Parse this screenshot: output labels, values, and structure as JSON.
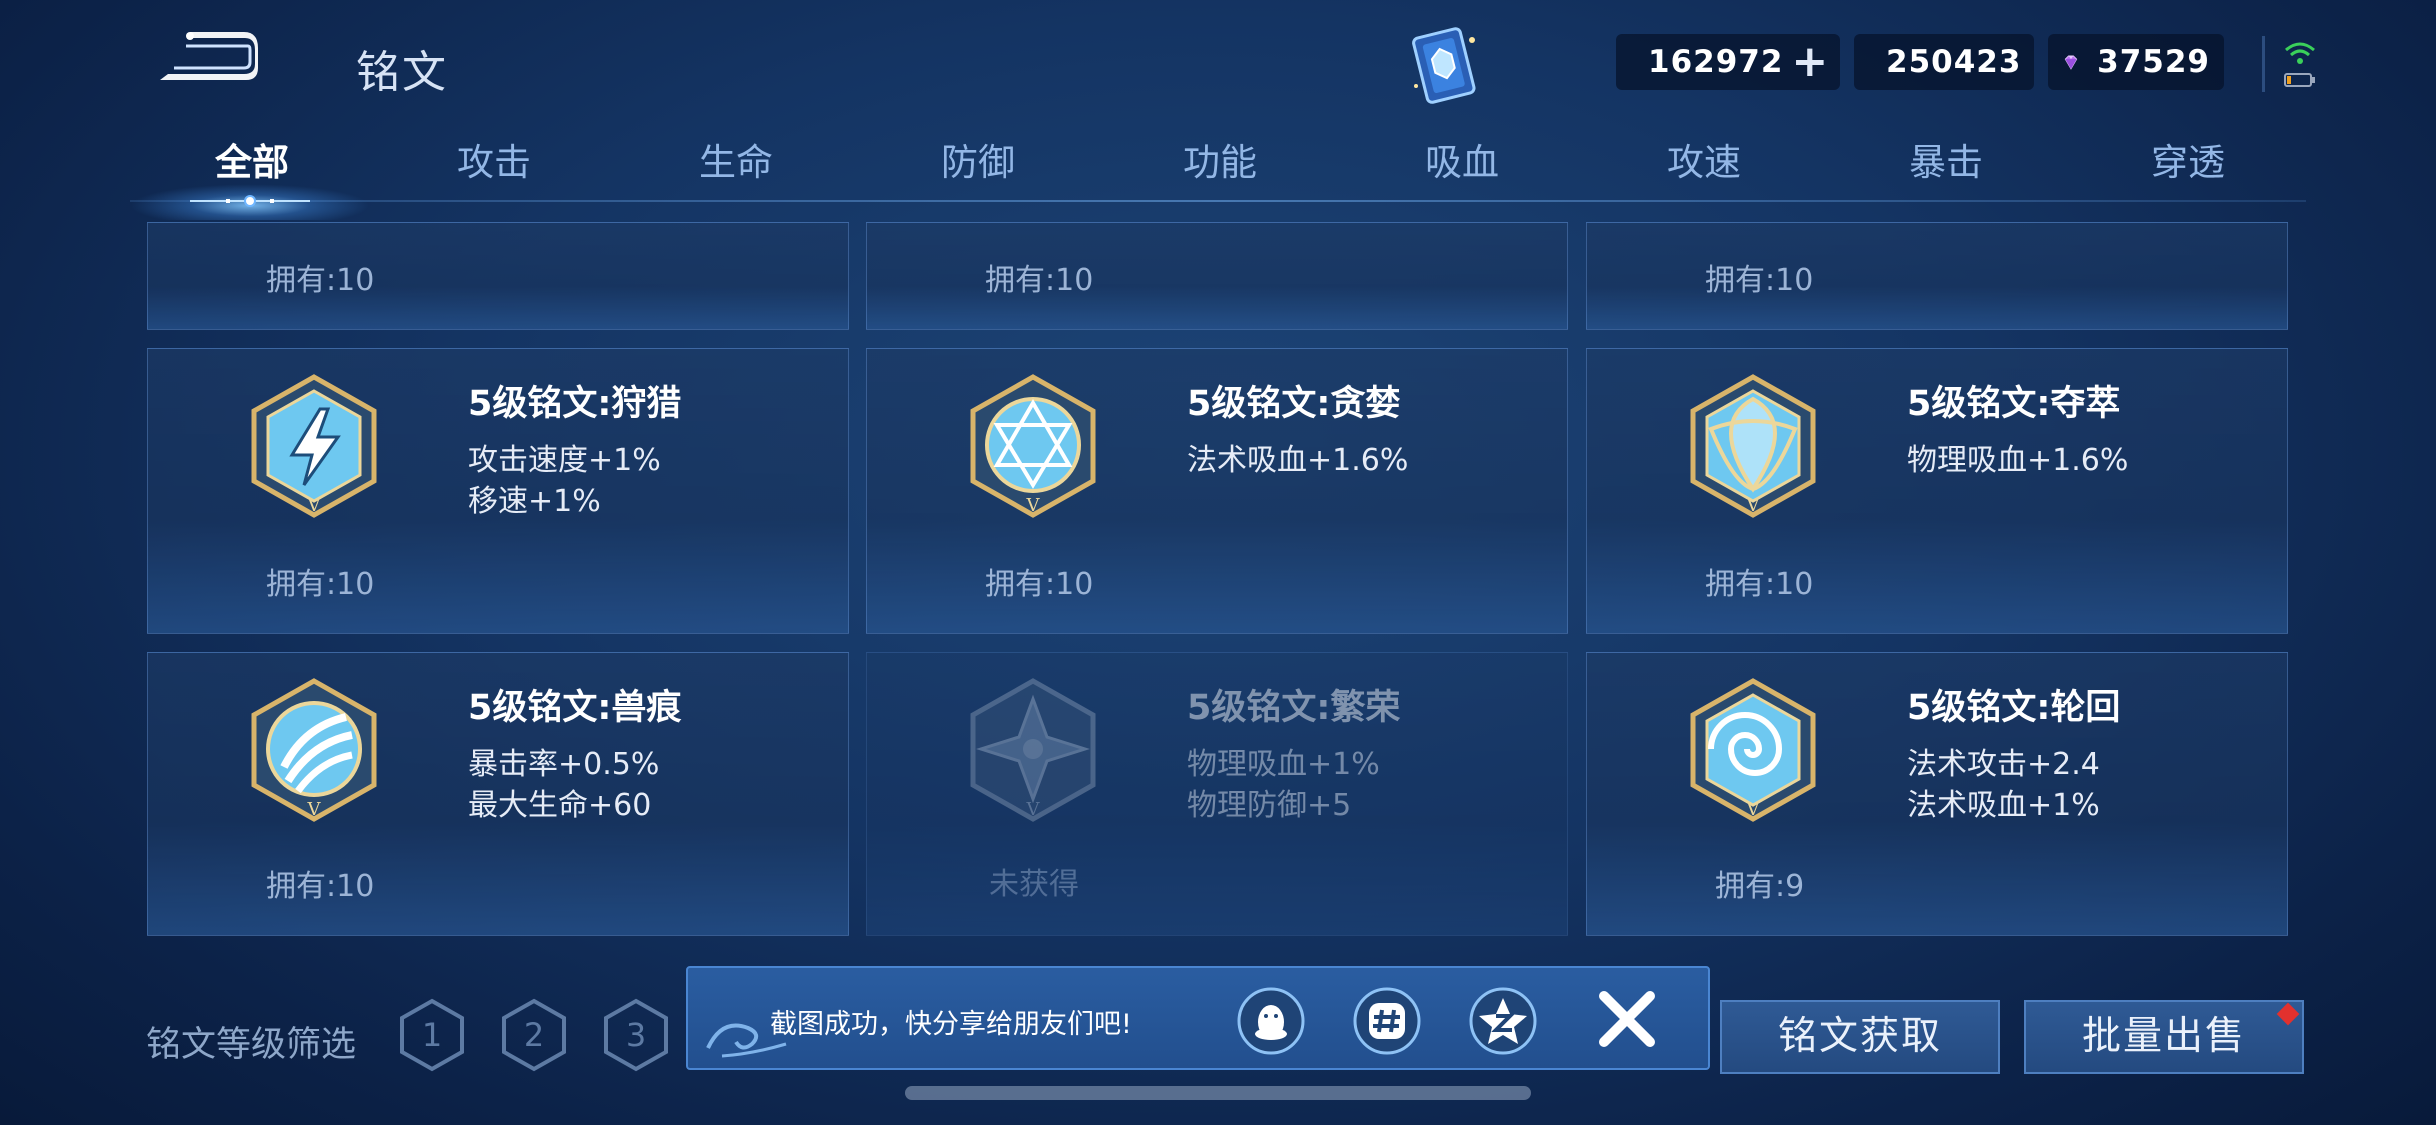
{
  "header": {
    "title": "铭文",
    "back_label": "",
    "currencies": [
      {
        "name": "diamond",
        "icon": "diamond-icon",
        "value": "162972",
        "has_plus": true,
        "plus": "+"
      },
      {
        "name": "gold",
        "icon": "gold-coin-icon",
        "value": "250423"
      },
      {
        "name": "gem",
        "icon": "purple-gem-icon",
        "value": "37529"
      }
    ]
  },
  "tabs": [
    {
      "label": "全部",
      "active": true
    },
    {
      "label": "攻击"
    },
    {
      "label": "生命"
    },
    {
      "label": "防御"
    },
    {
      "label": "功能"
    },
    {
      "label": "吸血"
    },
    {
      "label": "攻速"
    },
    {
      "label": "暴击"
    },
    {
      "label": "穿透"
    }
  ],
  "cards_top": [
    {
      "owned": "拥有:10"
    },
    {
      "owned": "拥有:10"
    },
    {
      "owned": "拥有:10"
    }
  ],
  "cards": [
    {
      "name": "5级铭文:狩猎",
      "attrs": [
        "攻击速度+1%",
        "移速+1%"
      ],
      "owned": "拥有:10",
      "emblem": "lightning-emblem-icon",
      "obtained": true
    },
    {
      "name": "5级铭文:贪婪",
      "attrs": [
        "法术吸血+1.6%"
      ],
      "owned": "拥有:10",
      "emblem": "star-emblem-icon",
      "obtained": true
    },
    {
      "name": "5级铭文:夺萃",
      "attrs": [
        "物理吸血+1.6%"
      ],
      "owned": "拥有:10",
      "emblem": "knot-emblem-icon",
      "obtained": true
    },
    {
      "name": "5级铭文:兽痕",
      "attrs": [
        "暴击率+0.5%",
        "最大生命+60"
      ],
      "owned": "拥有:10",
      "emblem": "claw-emblem-icon",
      "obtained": true
    },
    {
      "name": "5级铭文:繁荣",
      "attrs": [
        "物理吸血+1%",
        "物理防御+5"
      ],
      "owned": "未获得",
      "emblem": "flower-emblem-icon",
      "obtained": false
    },
    {
      "name": "5级铭文:轮回",
      "attrs": [
        "法术攻击+2.4",
        "法术吸血+1%"
      ],
      "owned": "拥有:9",
      "emblem": "spiral-emblem-icon",
      "obtained": true
    }
  ],
  "filter": {
    "label": "铭文等级筛选",
    "levels": [
      "1",
      "2",
      "3"
    ]
  },
  "share": {
    "text": "截图成功，快分享给朋友们吧!",
    "icons": [
      "qq-icon",
      "wechat-moments-icon",
      "qzone-icon"
    ]
  },
  "buttons": {
    "get": "铭文获取",
    "sell": "批量出售"
  },
  "colors": {
    "background": "#143463",
    "accent": "#4a86d2",
    "badge_red": "#e2312e"
  }
}
